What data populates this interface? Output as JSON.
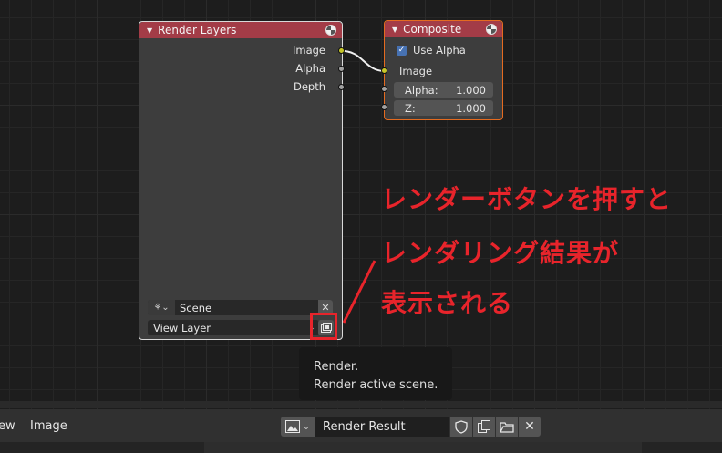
{
  "render_layers_node": {
    "title": "Render Layers",
    "outputs": [
      "Image",
      "Alpha",
      "Depth"
    ],
    "scene_value": "Scene",
    "view_layer_value": "View Layer"
  },
  "composite_node": {
    "title": "Composite",
    "use_alpha_label": "Use Alpha",
    "use_alpha_checked": true,
    "input_label": "Image",
    "alpha_label": "Alpha:",
    "alpha_value": "1.000",
    "z_label": "Z:",
    "z_value": "1.000"
  },
  "tooltip": {
    "line1": "Render.",
    "line2": "Render active scene."
  },
  "annotation": {
    "line1": "レンダーボタンを押すと",
    "line2": "レンダリング結果が",
    "line3": "表示される",
    "color": "#e8242b"
  },
  "image_editor_header": {
    "menu_view_partial": "ew",
    "menu_image": "Image",
    "image_name": "Render Result"
  },
  "colors": {
    "node_header": "#a33c47",
    "active_border": "#e46b20",
    "socket_color_image": "#c7c729",
    "socket_float": "#a1a1a1",
    "checkbox_blue": "#4772b3"
  }
}
